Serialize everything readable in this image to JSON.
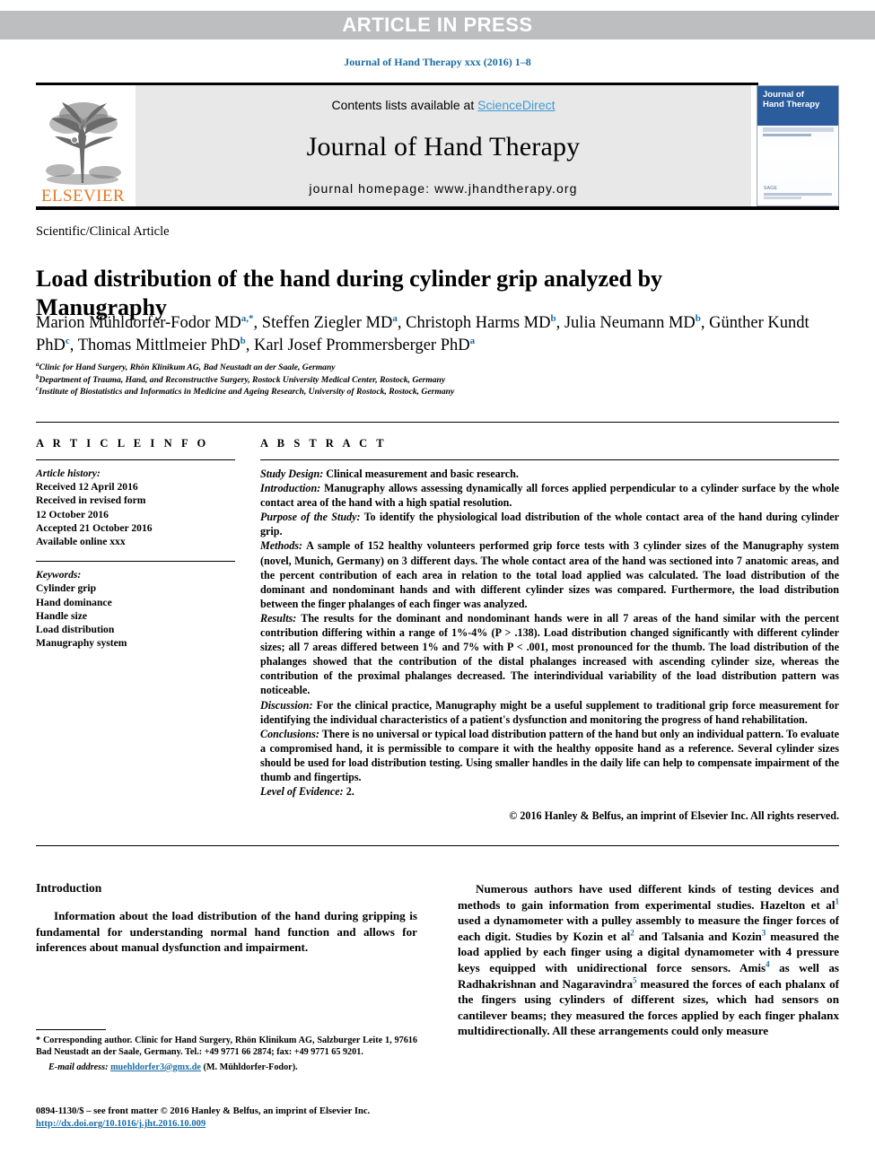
{
  "banner": {
    "text": "ARTICLE IN PRESS"
  },
  "journal_ref": "Journal of Hand Therapy xxx (2016) 1–8",
  "masthead": {
    "contents_prefix": "Contents lists available at ",
    "sciencedirect": "ScienceDirect",
    "journal_title": "Journal of Hand Therapy",
    "homepage": "journal homepage: www.jhandtherapy.org",
    "publisher_wordmark": "ELSEVIER",
    "cover_title_line1": "Journal of",
    "cover_title_line2": "Hand Therapy",
    "cover_footer_label": "SAGE"
  },
  "article": {
    "section_label": "Scientific/Clinical Article",
    "title": "Load distribution of the hand during cylinder grip analyzed by Manugraphy",
    "authors_line1_part1": "Marion Mühldorfer-Fodor MD",
    "authors_sup1": "a,*",
    "authors_line1_part2": ", Steffen Ziegler MD",
    "authors_sup2": "a",
    "authors_line1_part3": ", Christoph Harms MD",
    "authors_sup3": "b",
    "authors_line1_part4": ", Julia Neumann MD",
    "authors_sup4": "b",
    "authors_line1_part5": ",",
    "authors_line2_part1": "Günther Kundt PhD",
    "authors_sup5": "c",
    "authors_line2_part2": ", Thomas Mittlmeier PhD",
    "authors_sup6": "b",
    "authors_line2_part3": ", Karl Josef Prommersberger PhD",
    "authors_sup7": "a",
    "affiliations": [
      {
        "mark": "a",
        "text": "Clinic for Hand Surgery, Rhön Klinikum AG, Bad Neustadt an der Saale, Germany"
      },
      {
        "mark": "b",
        "text": "Department of Trauma, Hand, and Reconstructive Surgery, Rostock University Medical Center, Rostock, Germany"
      },
      {
        "mark": "c",
        "text": "Institute of Biostatistics and Informatics in Medicine and Ageing Research, University of Rostock, Rostock, Germany"
      }
    ]
  },
  "article_info": {
    "heading": "A R T I C L E  I N F O",
    "history_label": "Article history:",
    "history": [
      "Received 12 April 2016",
      "Received in revised form",
      "12 October 2016",
      "Accepted 21 October 2016",
      "Available online xxx"
    ],
    "keywords_label": "Keywords:",
    "keywords": [
      "Cylinder grip",
      "Hand dominance",
      "Handle size",
      "Load distribution",
      "Manugraphy system"
    ]
  },
  "abstract": {
    "heading": "A B S T R A C T",
    "sections": [
      {
        "lead": "Study Design:",
        "text": " Clinical measurement and basic research."
      },
      {
        "lead": "Introduction:",
        "text": " Manugraphy allows assessing dynamically all forces applied perpendicular to a cylinder surface by the whole contact area of the hand with a high spatial resolution."
      },
      {
        "lead": "Purpose of the Study:",
        "text": " To identify the physiological load distribution of the whole contact area of the hand during cylinder grip."
      },
      {
        "lead": "Methods:",
        "text": " A sample of 152 healthy volunteers performed grip force tests with 3 cylinder sizes of the Manugraphy system (novel, Munich, Germany) on 3 different days. The whole contact area of the hand was sectioned into 7 anatomic areas, and the percent contribution of each area in relation to the total load applied was calculated. The load distribution of the dominant and nondominant hands and with different cylinder sizes was compared. Furthermore, the load distribution between the finger phalanges of each finger was analyzed."
      },
      {
        "lead": "Results:",
        "text": " The results for the dominant and nondominant hands were in all 7 areas of the hand similar with the percent contribution differing within a range of 1%-4% (P > .138). Load distribution changed significantly with different cylinder sizes; all 7 areas differed between 1% and 7% with P < .001, most pronounced for the thumb. The load distribution of the phalanges showed that the contribution of the distal phalanges increased with ascending cylinder size, whereas the contribution of the proximal phalanges decreased. The interindividual variability of the load distribution pattern was noticeable."
      },
      {
        "lead": "Discussion:",
        "text": " For the clinical practice, Manugraphy might be a useful supplement to traditional grip force measurement for identifying the individual characteristics of a patient's dysfunction and monitoring the progress of hand rehabilitation."
      },
      {
        "lead": "Conclusions:",
        "text": " There is no universal or typical load distribution pattern of the hand but only an individual pattern. To evaluate a compromised hand, it is permissible to compare it with the healthy opposite hand as a reference. Several cylinder sizes should be used for load distribution testing. Using smaller handles in the daily life can help to compensate impairment of the thumb and fingertips."
      },
      {
        "lead": "Level of Evidence:",
        "text": " 2."
      }
    ],
    "copyright": "© 2016 Hanley & Belfus, an imprint of Elsevier Inc. All rights reserved."
  },
  "body": {
    "intro_heading": "Introduction",
    "intro_paragraph": "Information about the load distribution of the hand during gripping is fundamental for understanding normal hand function and allows for inferences about manual dysfunction and impairment.",
    "right_col": {
      "p1": "Numerous authors have used different kinds of testing devices and methods to gain information from experimental studies. Hazelton et al",
      "ref1": "1",
      "p2": " used a dynamometer with a pulley assembly to measure the finger forces of each digit. Studies by Kozin et al",
      "ref2": "2",
      "p3": " and Talsania and Kozin",
      "ref3": "3",
      "p4": " measured the load applied by each finger using a digital dynamometer with 4 pressure keys equipped with unidirectional force sensors. Amis",
      "ref4": "4",
      "p5": " as well as Radhakrishnan and Nagaravindra",
      "ref5": "5",
      "p6": " measured the forces of each phalanx of the fingers using cylinders of different sizes, which had sensors on cantilever beams; they measured the forces applied by each finger phalanx multidirectionally. All these arrangements could only measure"
    }
  },
  "footnotes": {
    "corresponding": "* Corresponding author. Clinic for Hand Surgery, Rhön Klinikum AG, Salzburger Leite 1, 97616 Bad Neustadt an der Saale, Germany. Tel.: +49 9771 66 2874; fax: +49 9771 65 9201.",
    "email_label": "E-mail address:",
    "email": "muehldorfer3@gmx.de",
    "email_suffix": " (M. Mühldorfer-Fodor)."
  },
  "page_footer": {
    "issn_line": "0894-1130/$ – see front matter © 2016 Hanley & Belfus, an imprint of Elsevier Inc.",
    "doi": "http://dx.doi.org/10.1016/j.jht.2016.10.009"
  },
  "colors": {
    "link_blue": "#1a6ca3",
    "sciencedirect_blue": "#3e9bd4",
    "banner_gray": "#bcbec0",
    "elsevier_orange": "#e87722",
    "cover_blue": "#2b5c9b"
  }
}
